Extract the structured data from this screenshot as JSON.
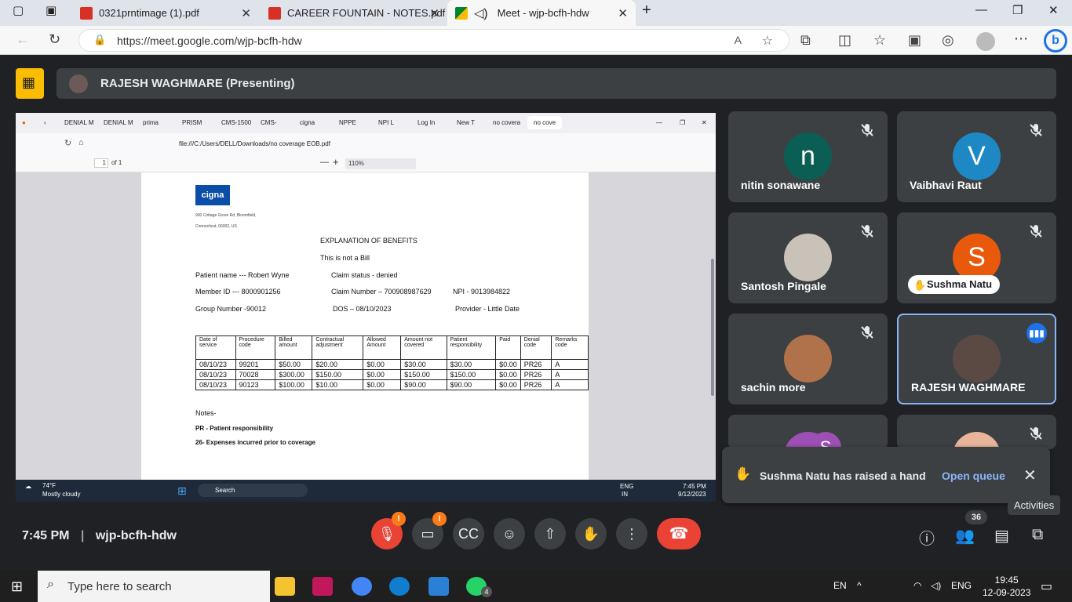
{
  "browser": {
    "tabs": [
      {
        "label": "0321prntimage (1).pdf",
        "icon": "pdf-icon"
      },
      {
        "label": "CAREER FOUNTAIN - NOTES.pdf",
        "icon": "pdf-icon"
      },
      {
        "label": "Meet - wjp-bcfh-hdw",
        "icon": "meet-icon",
        "active": true
      }
    ],
    "url": "https://meet.google.com/wjp-bcfh-hdw"
  },
  "presenting": {
    "label": "RAJESH WAGHMARE (Presenting)"
  },
  "shared_screen": {
    "firefox_tabs": [
      "DENIAL M",
      "DENIAL M",
      "prima",
      "PRISM",
      "CMS-1500",
      "CMS-",
      "cigna",
      "NPPE",
      "NPI L",
      "Log In",
      "New T",
      "no covera",
      "no cove"
    ],
    "file_url": "file:///C:/Users/DELL/Downloads/no coverage EOB.pdf",
    "page_num": "1",
    "page_of": "of 1",
    "zoom": "110%",
    "doc": {
      "logo": "cigna",
      "address_line1": "900 Cottage Grove Rd, Bloomfield,",
      "address_line2": "Connecticut, 06002, US",
      "title": "EXPLANATION OF BENEFITS",
      "subtitle": "This is not a Bill",
      "patient_name": "Patient name --- Robert Wyne",
      "claim_status": "Claim status - denied",
      "member_id": "Member ID --- 8000901256",
      "claim_number": "Claim Number – 700908987629",
      "npi": "NPI - 9013984822",
      "group_number": "Group Number -90012",
      "dos": "DOS – 08/10/2023",
      "provider": "Provider - Little Date",
      "table_headers": [
        "Date of service",
        "Procedure code",
        "Billed amount",
        "Contractual adjustment",
        "Allowed Amount",
        "Amount not covered",
        "Patient responsibility",
        "Paid",
        "Denial code",
        "Remarks code"
      ],
      "table_rows": [
        [
          "08/10/23",
          "99201",
          "$50.00",
          "$20.00",
          "$0.00",
          "$30.00",
          "$30.00",
          "$0.00",
          "PR26",
          "A"
        ],
        [
          "08/10/23",
          "70028",
          "$300.00",
          "$150.00",
          "$0.00",
          "$150.00",
          "$150.00",
          "$0.00",
          "PR26",
          "A"
        ],
        [
          "08/10/23",
          "90123",
          "$100.00",
          "$10.00",
          "$0.00",
          "$90.00",
          "$90.00",
          "$0.00",
          "PR26",
          "A"
        ]
      ],
      "notes_label": "Notes-",
      "note1": "PR - Patient responsibility",
      "note2": "26- Expenses incurred prior to coverage"
    },
    "win_taskbar": {
      "weather_temp": "74°F",
      "weather_desc": "Mostly cloudy",
      "search_placeholder": "Search",
      "lang": "ENG",
      "region": "IN",
      "time": "7:45 PM",
      "date": "9/12/2023"
    }
  },
  "participants": [
    {
      "name": "nitin sonawane",
      "initial": "n",
      "color": "#0b5e53",
      "muted": true
    },
    {
      "name": "Vaibhavi Raut",
      "initial": "V",
      "color": "#1e88c5",
      "muted": true
    },
    {
      "name": "Santosh Pingale",
      "initial": "",
      "color": "#c9c2b8",
      "muted": true,
      "photo": true
    },
    {
      "name": "Sushma Natu",
      "initial": "S",
      "color": "#e8590c",
      "muted": true,
      "hand_raised": true
    },
    {
      "name": "sachin more",
      "initial": "",
      "color": "#b0724a",
      "muted": true,
      "photo": true
    },
    {
      "name": "RAJESH WAGHMARE",
      "initial": "",
      "color": "#5b4a44",
      "muted": false,
      "speaking": true,
      "photo": true
    },
    {
      "name": "",
      "initial": "S",
      "color": "#9c4fb5",
      "muted": false,
      "photo": true
    },
    {
      "name": "",
      "initial": "",
      "color": "#e8b59a",
      "muted": true,
      "photo": true
    }
  ],
  "notification": {
    "text": "Sushma Natu has raised a hand",
    "action": "Open queue"
  },
  "meeting": {
    "time": "7:45 PM",
    "code": "wjp-bcfh-hdw",
    "participant_count": "36",
    "activities_tooltip": "Activities",
    "mic_badge": "!",
    "cam_badge": "!"
  },
  "taskbar": {
    "search_placeholder": "Type here to search",
    "lang": "EN",
    "lang2": "ENG",
    "time": "19:45",
    "date": "12-09-2023",
    "whatsapp_badge": "4"
  }
}
